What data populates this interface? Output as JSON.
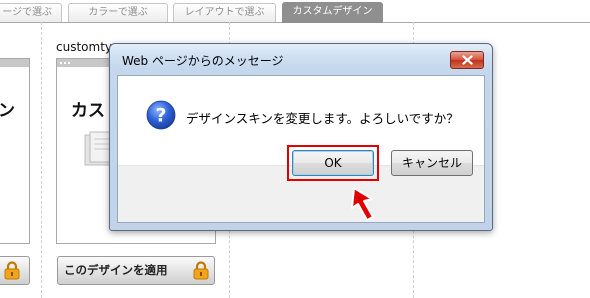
{
  "tabs": [
    {
      "label": "ージで選ぶ",
      "active": false
    },
    {
      "label": "カラーで選ぶ",
      "active": false
    },
    {
      "label": "レイアウトで選ぶ",
      "active": false
    },
    {
      "label": "カスタムデザイン",
      "active": true
    }
  ],
  "cards": {
    "left": {
      "heading": "ン",
      "apply_label": ""
    },
    "custom": {
      "caption": "customty",
      "heading": "カス",
      "apply_label": "このデザインを適用"
    }
  },
  "dialog": {
    "title": "Web ページからのメッセージ",
    "message": "デザインスキンを変更します。よろしいですか？",
    "ok_label": "OK",
    "cancel_label": "キャンセル"
  },
  "colors": {
    "highlight": "#e00000",
    "active_tab": "#8f8f8f",
    "dialog_frame": "#c4d7ec",
    "close_button": "#c0321b",
    "lock_icon": "#f2a51a"
  },
  "icons": [
    "question-icon",
    "close-icon",
    "lock-icon",
    "red-pointer-arrow"
  ]
}
